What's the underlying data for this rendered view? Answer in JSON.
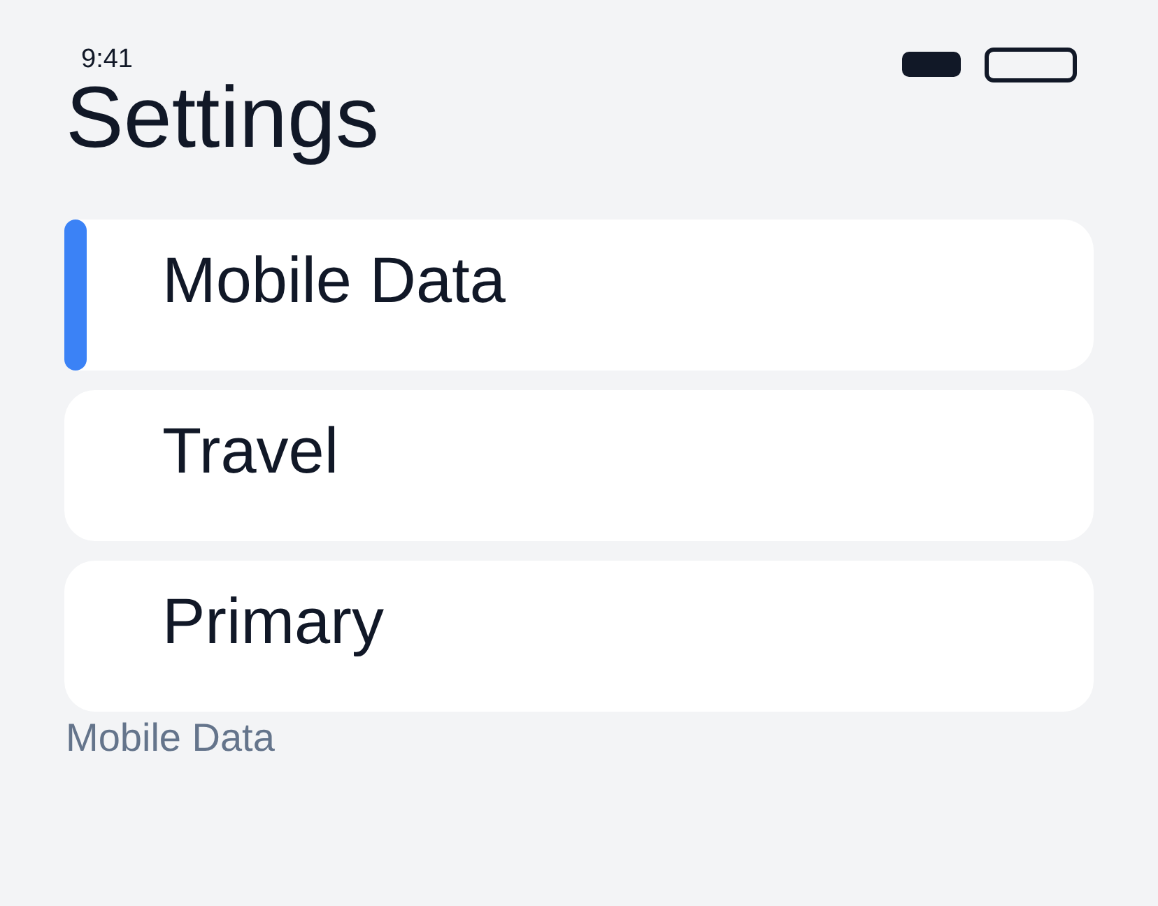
{
  "status_bar": {
    "time": "9:41"
  },
  "title": "Settings",
  "items": [
    {
      "label": "Mobile Data",
      "selected": true
    },
    {
      "label": "Travel",
      "selected": false
    },
    {
      "label": "Primary",
      "selected": false
    }
  ],
  "caption": "Mobile Data"
}
